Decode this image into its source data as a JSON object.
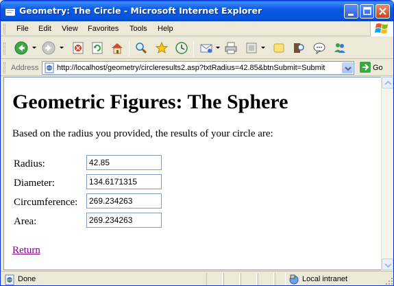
{
  "window": {
    "title": "Geometry: The Circle - Microsoft Internet Explorer"
  },
  "menubar": {
    "items": [
      "File",
      "Edit",
      "View",
      "Favorites",
      "Tools",
      "Help"
    ]
  },
  "address": {
    "label": "Address",
    "url": "http://localhost/geometry/circleresults2.asp?txtRadius=42.85&btnSubmit=Submit",
    "go_label": "Go"
  },
  "page": {
    "heading": "Geometric Figures: The Sphere",
    "intro": "Based on the radius you provided, the results of your circle are:",
    "rows": [
      {
        "label": "Radius:",
        "value": "42.85"
      },
      {
        "label": "Diameter:",
        "value": "134.6171315"
      },
      {
        "label": "Circumference:",
        "value": "269.234263"
      },
      {
        "label": "Area:",
        "value": "269.234263"
      }
    ],
    "return_link": "Return"
  },
  "statusbar": {
    "status": "Done",
    "zone": "Local intranet"
  },
  "colors": {
    "titlebar": "#0a5ae6",
    "visited_link": "#800080",
    "field_border": "#7f9db9"
  }
}
